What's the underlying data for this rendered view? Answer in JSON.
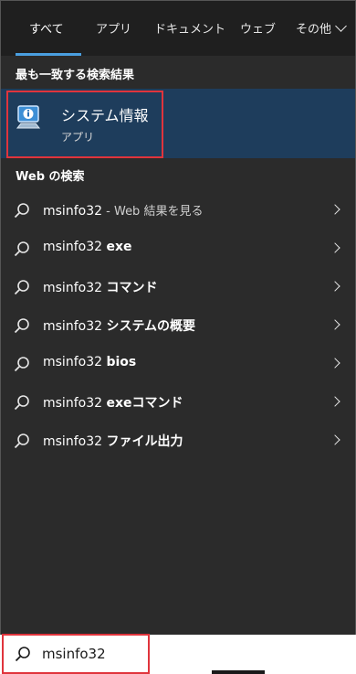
{
  "tabs": [
    {
      "label": "すべて"
    },
    {
      "label": "アプリ"
    },
    {
      "label": "ドキュメント"
    },
    {
      "label": "ウェブ"
    },
    {
      "label": "その他"
    }
  ],
  "best_match": {
    "title": "最も一致する検索結果",
    "app_name": "システム情報",
    "app_type": "アプリ"
  },
  "web": {
    "title": "Web の検索",
    "results": [
      {
        "query": "msinfo32",
        "suffix": "",
        "sub": " - Web 結果を見る"
      },
      {
        "query": "msinfo32 ",
        "suffix": "exe",
        "sub": ""
      },
      {
        "query": "msinfo32 ",
        "suffix": "コマンド",
        "sub": ""
      },
      {
        "query": "msinfo32 ",
        "suffix": "システムの概要",
        "sub": ""
      },
      {
        "query": "msinfo32 ",
        "suffix": "bios",
        "sub": ""
      },
      {
        "query": "msinfo32 ",
        "suffix": "exeコマンド",
        "sub": ""
      },
      {
        "query": "msinfo32 ",
        "suffix": "ファイル出力",
        "sub": ""
      }
    ]
  },
  "search": {
    "value": "msinfo32"
  },
  "colors": {
    "accent": "#4a9fe0",
    "highlight_bg": "#1e3d5c",
    "annotation_red": "#e0343c"
  }
}
